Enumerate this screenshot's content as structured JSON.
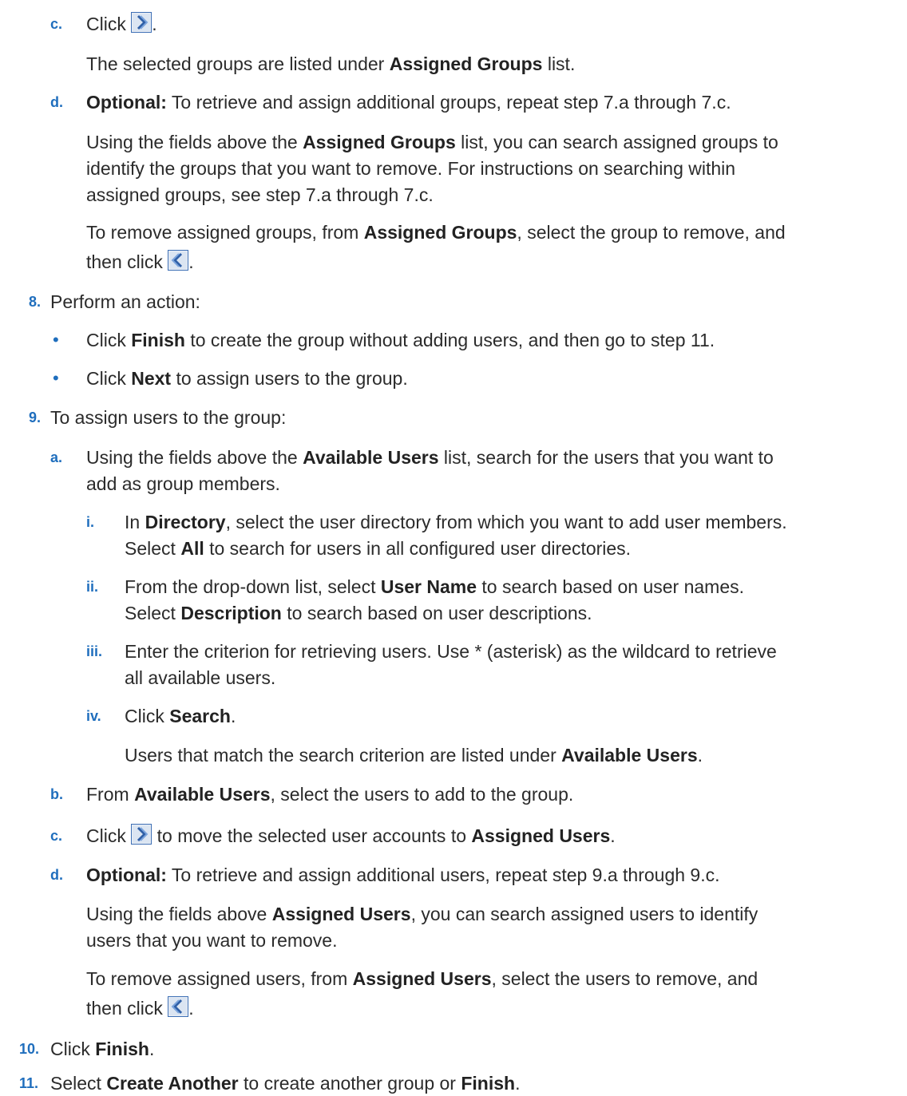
{
  "c1": {
    "marker": "c.",
    "click": "Click",
    "after": "."
  },
  "c1_note": {
    "pre": "The selected groups are listed under",
    "bold": "Assigned Groups",
    "post": "list."
  },
  "d1": {
    "marker": "d.",
    "opt": "Optional:",
    "text": "To retrieve and assign additional groups, repeat step 7.a through 7.c."
  },
  "d1_p1": {
    "l1_pre": "Using the fields above the",
    "l1_bold": "Assigned Groups",
    "l1_post": "list, you can search assigned groups to",
    "l2": "identify the groups that you want to remove. For instructions on searching within",
    "l3": "assigned groups, see step 7.a through 7.c."
  },
  "d1_p2": {
    "l1_pre": "To remove assigned groups, from",
    "l1_bold": "Assigned Groups",
    "l1_post": ", select the group to remove, and",
    "l2": "then click",
    "after": "."
  },
  "s8": {
    "marker": "8.",
    "text": "Perform an action:"
  },
  "s8_b1": {
    "pre": "Click",
    "bold": "Finish",
    "post": "to create the group without adding users, and then go to step 11."
  },
  "s8_b2": {
    "pre": "Click",
    "bold": "Next",
    "post": "to assign users to the group."
  },
  "s9": {
    "marker": "9.",
    "text": "To assign users to the group:"
  },
  "s9a": {
    "marker": "a.",
    "l1_pre": "Using the fields above the",
    "l1_bold": "Available Users",
    "l1_post": "list, search for the users that you want to",
    "l2": "add as group members."
  },
  "s9a_i": {
    "marker": "i.",
    "l1_pre": "In",
    "l1_bold": "Directory",
    "l1_post": ", select the user directory from which you want to add user members.",
    "l2_pre": "Select",
    "l2_bold": "All",
    "l2_post": "to search for users in all configured user directories."
  },
  "s9a_ii": {
    "marker": "ii.",
    "l1_pre": "From the drop-down list, select",
    "l1_bold": "User Name",
    "l1_post": "to search based on user names.",
    "l2_pre": "Select",
    "l2_bold": "Description",
    "l2_post": "to search based on user descriptions."
  },
  "s9a_iii": {
    "marker": "iii.",
    "l1": "Enter the criterion for retrieving users. Use * (asterisk) as the wildcard to retrieve",
    "l2": "all available users."
  },
  "s9a_iv": {
    "marker": "iv.",
    "pre": "Click",
    "bold": "Search",
    "after": "."
  },
  "s9a_note": {
    "pre": "Users that match the search criterion are listed under",
    "bold": "Available Users",
    "after": "."
  },
  "s9b": {
    "marker": "b.",
    "pre": "From",
    "bold": "Available Users",
    "post": ", select the users to add to the group."
  },
  "s9c": {
    "marker": "c.",
    "pre": "Click",
    "mid": "to move the selected user accounts to",
    "bold": "Assigned Users",
    "after": "."
  },
  "s9d": {
    "marker": "d.",
    "opt": "Optional:",
    "text": "To retrieve and assign additional users, repeat step 9.a through 9.c."
  },
  "s9d_p1": {
    "l1_pre": "Using the fields above",
    "l1_bold": "Assigned Users",
    "l1_post": ", you can search assigned users to identify",
    "l2": "users that you want to remove."
  },
  "s9d_p2": {
    "l1_pre": "To remove assigned users, from",
    "l1_bold": "Assigned Users",
    "l1_post": ", select the users to remove, and",
    "l2": "then click",
    "after": "."
  },
  "s10": {
    "marker": "10.",
    "pre": "Click",
    "bold": "Finish",
    "after": "."
  },
  "s11": {
    "marker": "11.",
    "pre": "Select",
    "bold1": "Create Another",
    "mid": "to create another group or",
    "bold2": "Finish",
    "after": "."
  },
  "icons": {
    "move_right": "move-right-icon",
    "move_left": "move-left-icon"
  },
  "colors": {
    "marker": "#1f6ebd",
    "text": "#2b2b2b",
    "icon_border": "#3d6fb5"
  }
}
